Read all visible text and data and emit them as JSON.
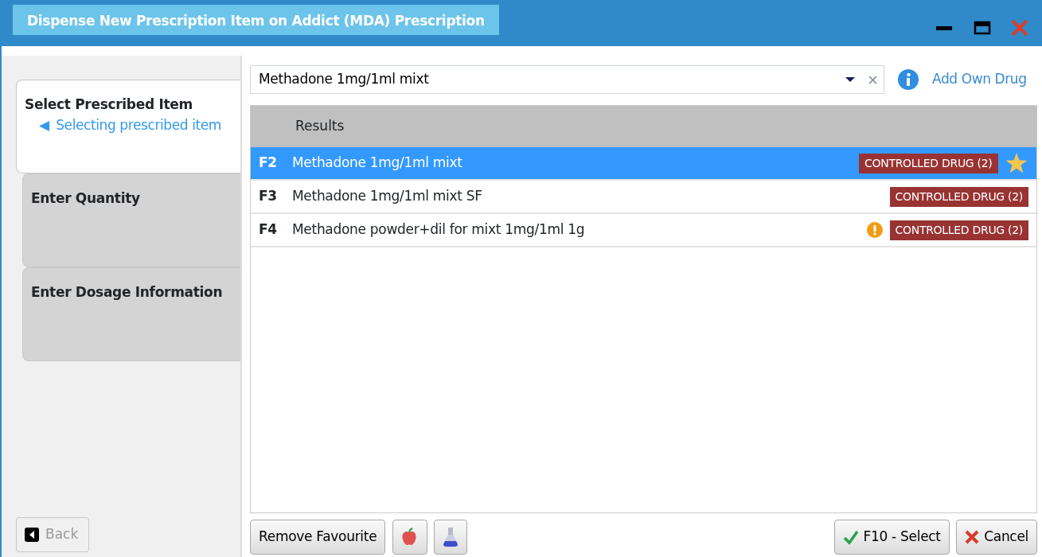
{
  "window": {
    "title": "Dispense New Prescription Item on Addict (MDA) Prescription"
  },
  "steps": [
    {
      "label": "Select Prescribed Item",
      "selected": true,
      "substep": {
        "marker": "◀",
        "label": "Selecting prescribed item"
      }
    },
    {
      "label": "Enter Quantity",
      "selected": false
    },
    {
      "label": "Enter Dosage Information",
      "selected": false
    }
  ],
  "back_button": {
    "label": "Back",
    "disabled": true
  },
  "search": {
    "value": "Methadone 1mg/1ml mixt"
  },
  "add_own_drug": "Add Own Drug",
  "results": {
    "heading": "Results",
    "rows": [
      {
        "key": "F2",
        "name": "Methadone 1mg/1ml mixt",
        "badge": "CONTROLLED DRUG (2)",
        "selected": true,
        "favourite": true,
        "warning": false
      },
      {
        "key": "F3",
        "name": "Methadone 1mg/1ml mixt SF",
        "badge": "CONTROLLED DRUG (2)",
        "selected": false,
        "favourite": false,
        "warning": false
      },
      {
        "key": "F4",
        "name": "Methadone powder+dil for mixt 1mg/1ml 1g",
        "badge": "CONTROLLED DRUG (2)",
        "selected": false,
        "favourite": false,
        "warning": true
      }
    ]
  },
  "buttons": {
    "remove_favourite": "Remove Favourite",
    "select": "F10 - Select",
    "cancel": "Cancel"
  }
}
